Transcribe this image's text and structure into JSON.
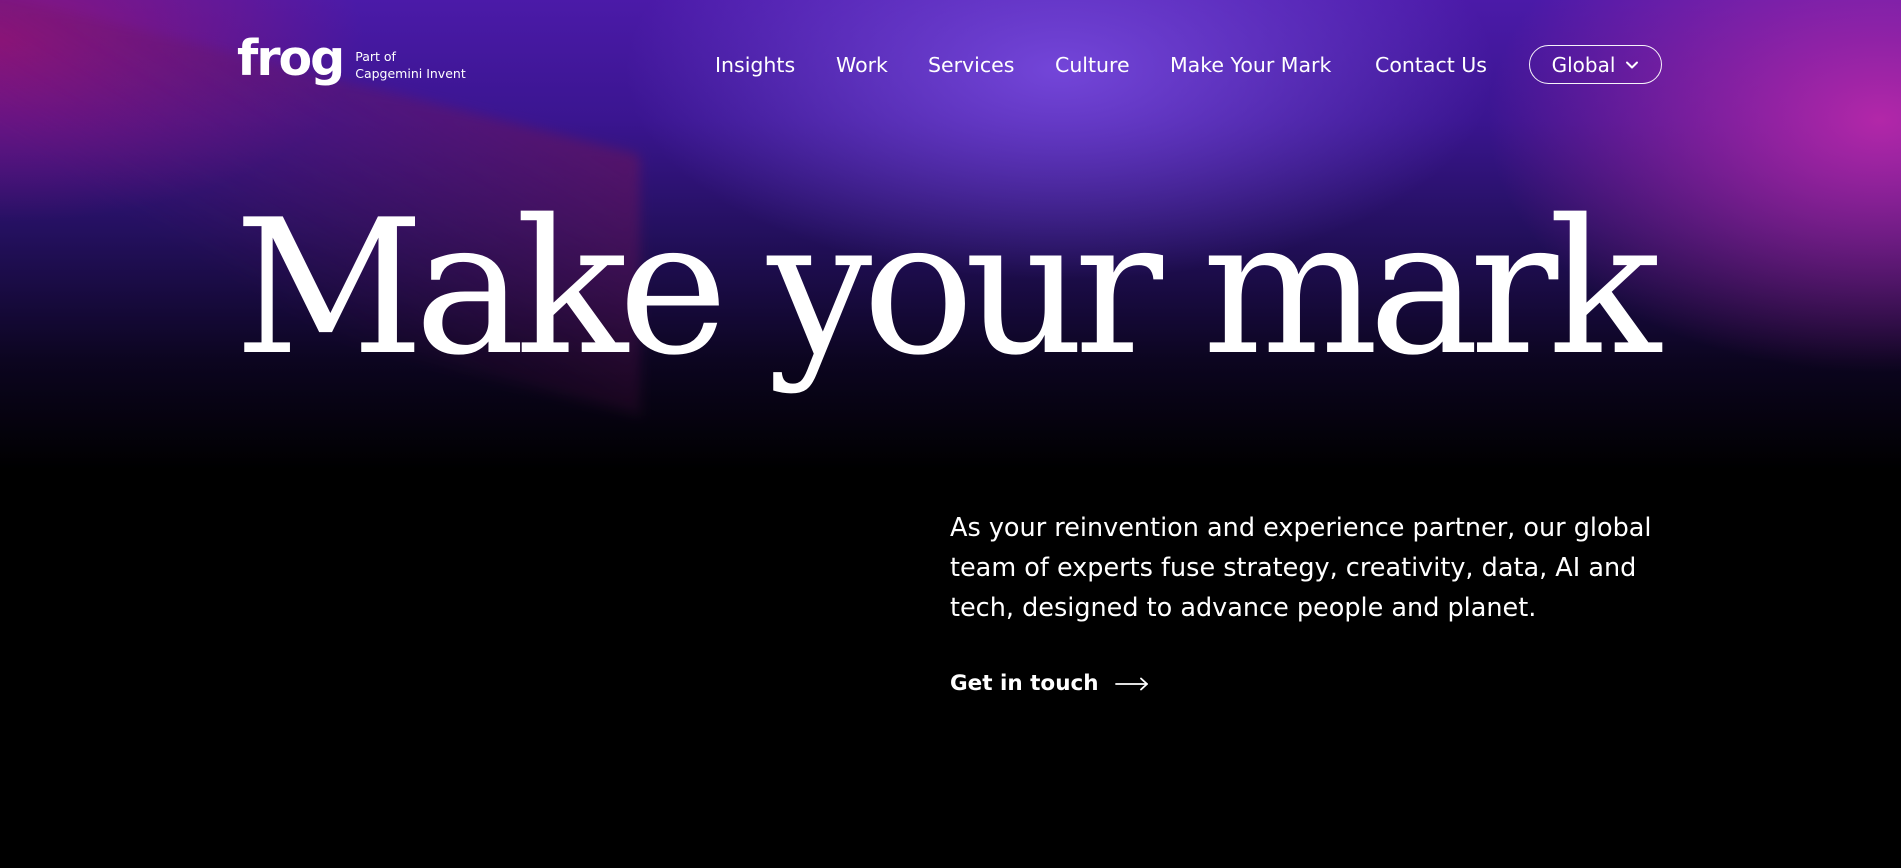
{
  "header": {
    "logo": {
      "word": "frog",
      "sub_line1": "Part of",
      "sub_line2": "Capgemini Invent"
    },
    "nav": [
      {
        "label": "Insights"
      },
      {
        "label": "Work"
      },
      {
        "label": "Services"
      },
      {
        "label": "Culture"
      },
      {
        "label": "Make Your Mark"
      },
      {
        "label": "Contact Us"
      }
    ],
    "region": {
      "label": "Global",
      "icon": "chevron-down-icon"
    }
  },
  "hero": {
    "title": "Make your mark",
    "copy": "As your reinvention and experience partner, our global team of experts fuse strategy, creativity, data, AI and tech, designed to advance people and planet.",
    "cta": {
      "label": "Get in touch",
      "icon": "arrow-right-icon"
    }
  },
  "colors": {
    "background": "#000000",
    "gradient_violet": "#4b1aa8",
    "gradient_magenta": "#b928aa",
    "text": "#ffffff"
  }
}
